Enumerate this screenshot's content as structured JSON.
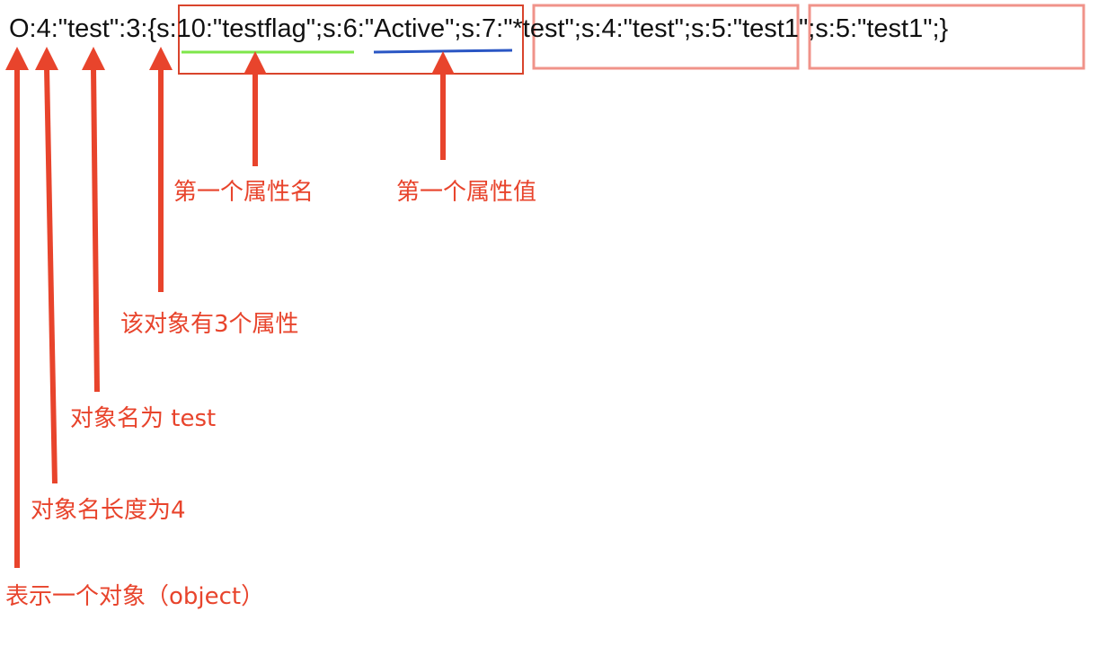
{
  "serialized": {
    "prefix": "O:4:\"test\":3:{",
    "attr1_name": "s:10:\"testflag\"",
    "sep1": ";",
    "attr1_value": "s:6:\"Active\"",
    "sep2": ";",
    "attr2": "s:7:\"*test\";s:4:\"test\"",
    "sep3": ";",
    "attr3": "s:5:\"test1\";s:5:\"test1\"",
    "suffix": ";}"
  },
  "annotations": {
    "first_attr_name": "第一个属性名",
    "first_attr_value": "第一个属性值",
    "prop_count": "该对象有3个属性",
    "object_name": "对象名为 test",
    "name_length": "对象名长度为4",
    "object_marker": "表示一个对象（object）"
  },
  "colors": {
    "arrow": "#e8442c",
    "main_box": "#d9442c",
    "light_box": "#f0938a",
    "name_underline": "#7ee64a",
    "value_underline": "#2a56c4",
    "text": "#111111"
  }
}
